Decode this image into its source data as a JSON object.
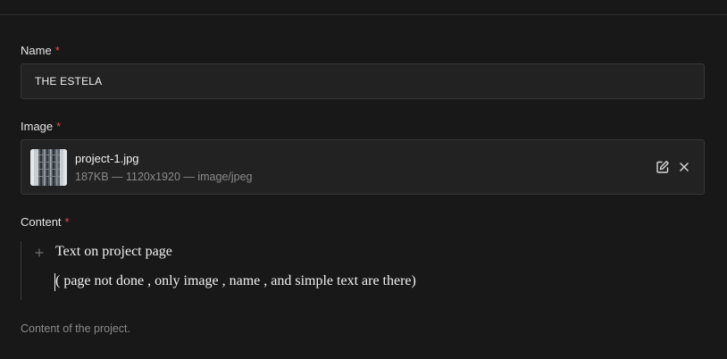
{
  "fields": {
    "name": {
      "label": "Name",
      "required_mark": "*",
      "value": "THE ESTELA"
    },
    "image": {
      "label": "Image",
      "required_mark": "*",
      "file_name": "project-1.jpg",
      "file_meta": "187KB — 1120x1920 — image/jpeg",
      "edit_icon": "pencil-square-icon",
      "remove_icon": "close-icon"
    },
    "content": {
      "label": "Content",
      "required_mark": "*",
      "lines": [
        "Text on project page",
        "( page not done , only image , name , and simple text are there)"
      ],
      "hint": "Content of the project."
    }
  },
  "colors": {
    "background": "#181818",
    "field_bg": "#222222",
    "border": "#363636",
    "required": "#e5484d",
    "muted": "#8a8a8a"
  }
}
